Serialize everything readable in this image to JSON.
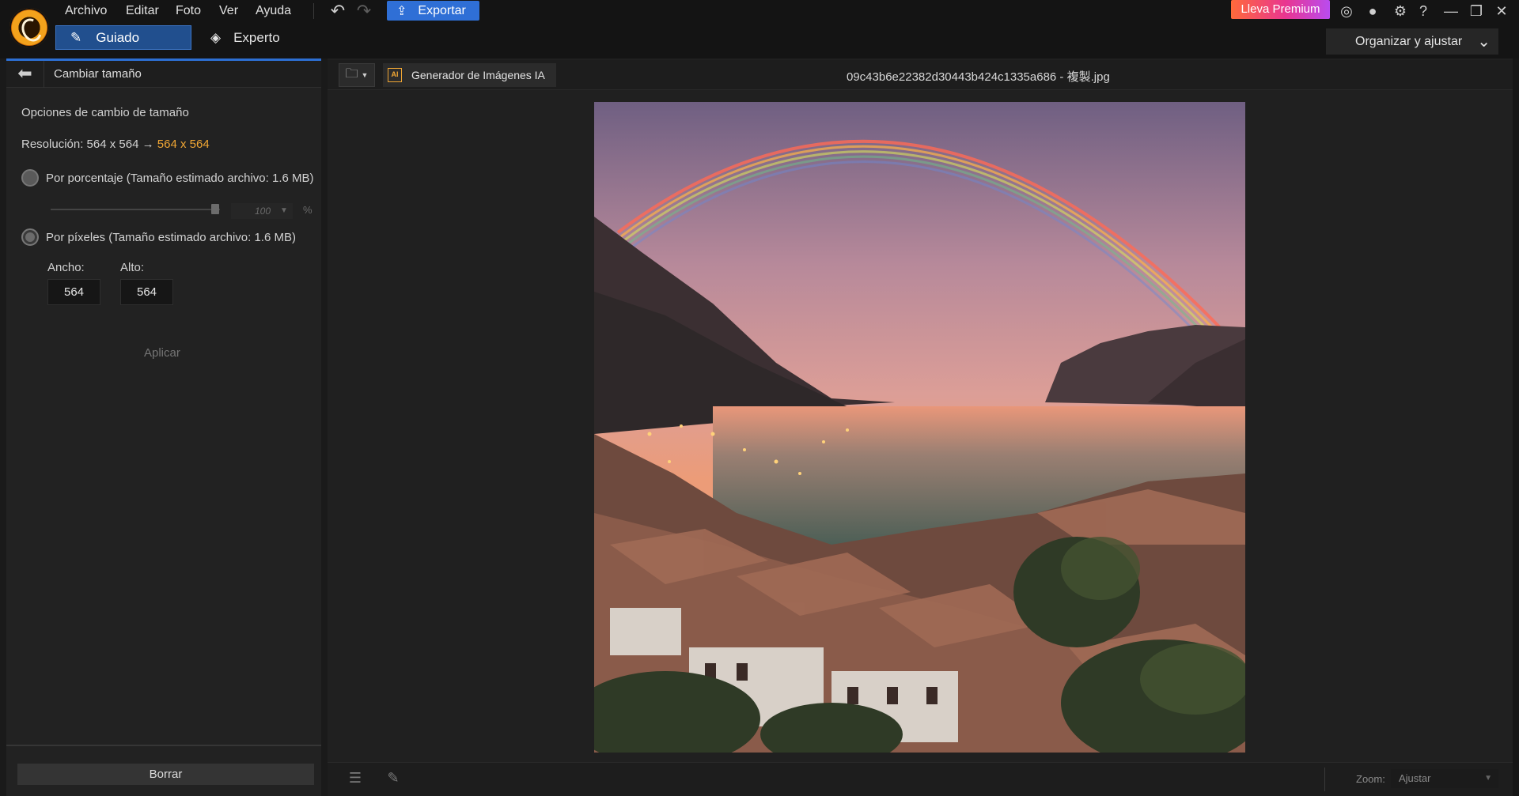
{
  "menu": [
    "Archivo",
    "Editar",
    "Foto",
    "Ver",
    "Ayuda"
  ],
  "toolbar": {
    "undo_icon": "undo-icon",
    "redo_icon": "redo-icon",
    "export_label": "Exportar"
  },
  "premium_label": "Lleva Premium",
  "modes": {
    "guided": "Guiado",
    "expert": "Experto"
  },
  "organize": "Organizar y ajustar",
  "panel": {
    "title": "Cambiar tamaño",
    "section_title": "Opciones de cambio de tamaño",
    "resolution_prefix": "Resolución: 564 x 564 →",
    "resolution_new": "564 x 564",
    "option_percent": "Por porcentaje (Tamaño estimado archivo: 1.6 MB)",
    "percent_value": "100",
    "percent_unit": "%",
    "option_pixels": "Por píxeles (Tamaño estimado archivo: 1.6 MB)",
    "width_label": "Ancho:",
    "height_label": "Alto:",
    "width_value": "564",
    "height_value": "564",
    "apply": "Aplicar",
    "clear": "Borrar"
  },
  "main": {
    "ai_generator": "Generador de Imágenes IA",
    "file_name": "09c43b6e22382d30443b424c1335a686 - 複製.jpg"
  },
  "zoom": {
    "label": "Zoom:",
    "value": "Ajustar"
  },
  "colors": {
    "accent": "#2f6fd6",
    "highlight": "#f0a634",
    "premium_start": "#ff6a3a",
    "premium_end": "#b94cf0"
  }
}
